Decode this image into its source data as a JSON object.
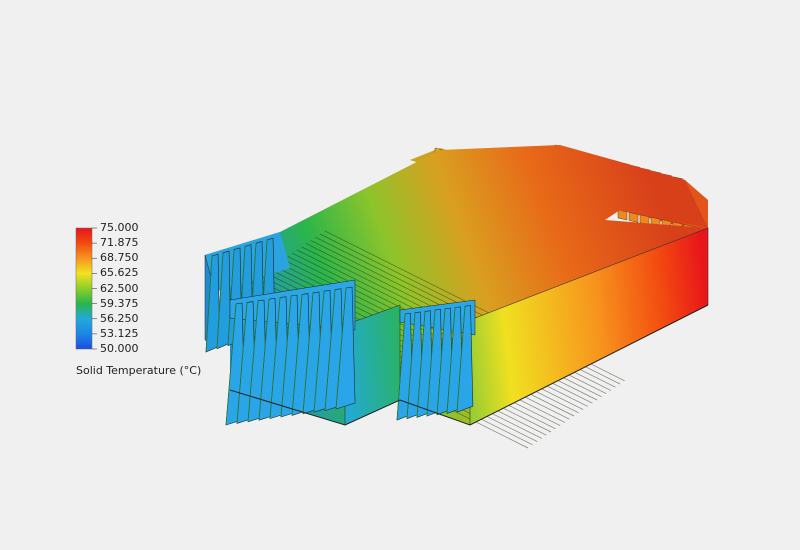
{
  "legend": {
    "title": "Solid Temperature (°C)",
    "ticks": [
      "75.000",
      "71.875",
      "68.750",
      "65.625",
      "62.500",
      "59.375",
      "56.250",
      "53.125",
      "50.000"
    ],
    "colors": [
      "#e8151a",
      "#f24a10",
      "#f7941d",
      "#f3e221",
      "#8ccf2b",
      "#2bb54a",
      "#22a9d8",
      "#1c87e6",
      "#1a4fe0"
    ]
  }
}
